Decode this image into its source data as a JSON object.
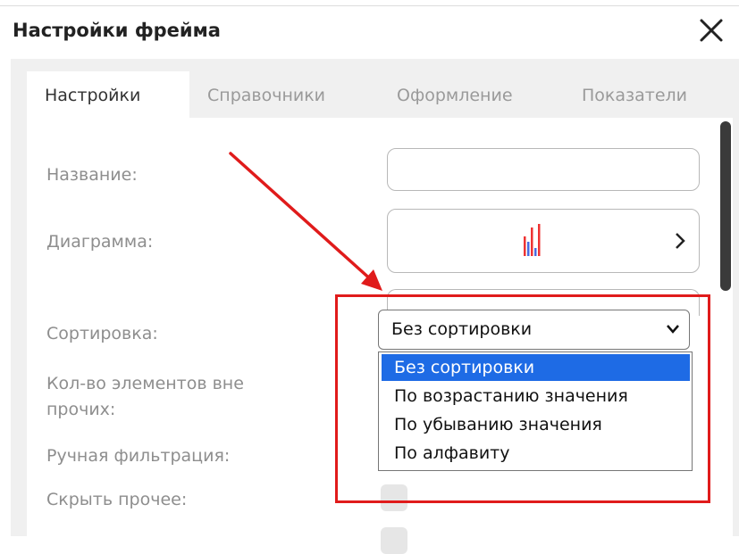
{
  "dialog": {
    "title": "Настройки фрейма",
    "close_icon": "close-icon"
  },
  "tabs": [
    {
      "label": "Настройки",
      "active": true
    },
    {
      "label": "Справочники",
      "active": false
    },
    {
      "label": "Оформление",
      "active": false
    },
    {
      "label": "Показатели",
      "active": false
    }
  ],
  "form": {
    "name_label": "Название:",
    "name_value": "",
    "diagram_label": "Диаграмма:",
    "diagram_icon": "bar-chart-icon",
    "sort_label": "Сортировка:",
    "sort_value": "Без сортировки",
    "sort_options": [
      "Без сортировки",
      "По возрастанию значения",
      "По убыванию значения",
      "По алфавиту"
    ],
    "count_label_line1": "Кол-во элементов вне",
    "count_label_line2": "прочих:",
    "manual_filter_label": "Ручная фильтрация:",
    "hide_other_label": "Скрыть прочее:"
  },
  "colors": {
    "accent": "#1e6be5",
    "annotation": "#e01b1b",
    "label": "#8e8e8e",
    "panel": "#f0f0f0"
  }
}
